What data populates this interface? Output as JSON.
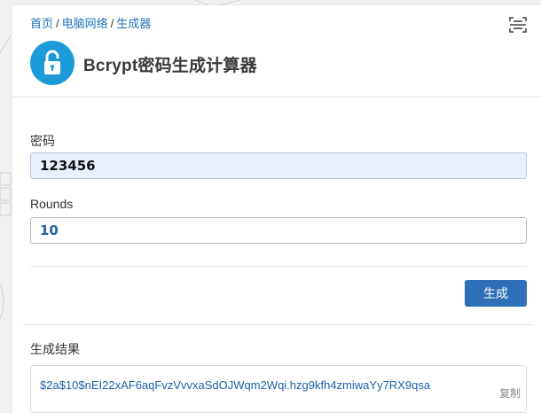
{
  "breadcrumb": {
    "home": "首页",
    "category": "电脑网络",
    "current": "生成器",
    "separator": "/"
  },
  "header": {
    "title": "Bcrypt密码生成计算器",
    "logo_icon": "lock-icon",
    "scan_icon": "scan-icon",
    "logo_color": "#1b9bd7"
  },
  "form": {
    "password_label": "密码",
    "password_value": "123456",
    "rounds_label": "Rounds",
    "rounds_value": "10",
    "generate_label": "生成"
  },
  "result": {
    "label": "生成结果",
    "hash": "$2a$10$nEI22xAF6aqFvzVvvxaSdOJWqm2Wqi.hzg9kfh4zmiwaYy7RX9qsa",
    "copy_label": "复制"
  },
  "colors": {
    "accent": "#2d6fb8",
    "link": "#1e73be"
  }
}
